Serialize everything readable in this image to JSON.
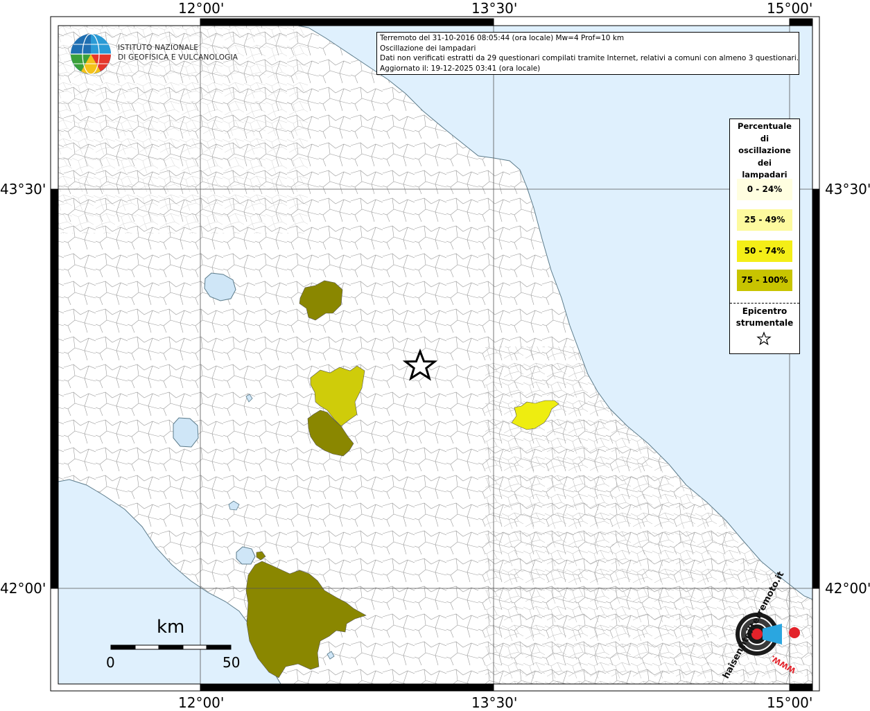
{
  "info": {
    "line1": "Terremoto del 31-10-2016 08:05:44 (ora locale) Mw=4 Prof=10 km",
    "line2": "Oscillazione dei lampadari",
    "line3": "Dati non verificati estratti da 29 questionari compilati tramite Internet, relativi a comuni con almeno 3 questionari.",
    "line4": "Aggiornato il: 19-12-2025 03:41 (ora locale)"
  },
  "axes": {
    "lon_labels": [
      "12°00'",
      "13°30'",
      "15°00'"
    ],
    "lat_labels": [
      "43°30'",
      "42°00'"
    ]
  },
  "logo": {
    "line1": "ISTITUTO NAZIONALE",
    "line2": "DI GEOFISICA E VULCANOLOGIA"
  },
  "legend": {
    "title": "Percentuale di oscillazione dei lampadari",
    "classes": [
      {
        "label": "0 - 24%",
        "color": "#fffee0"
      },
      {
        "label": "25 - 49%",
        "color": "#fdfa9e"
      },
      {
        "label": "50 - 74%",
        "color": "#f4ee17"
      },
      {
        "label": "75 - 100%",
        "color": "#c8c400"
      }
    ],
    "epicenter_label": "Epicentro strumentale"
  },
  "scale": {
    "unit": "km",
    "min": "0",
    "max": "50"
  },
  "watermark": {
    "site": "haisentitoilterremoto.it",
    "url": "WWW."
  },
  "colors": {
    "sea": "#dff0fd",
    "land": "#ffffff",
    "dark_olive": "#8a8700",
    "yellow_olive": "#cfcc0a",
    "yellow": "#eeed10",
    "lake": "#cfe6f7"
  }
}
